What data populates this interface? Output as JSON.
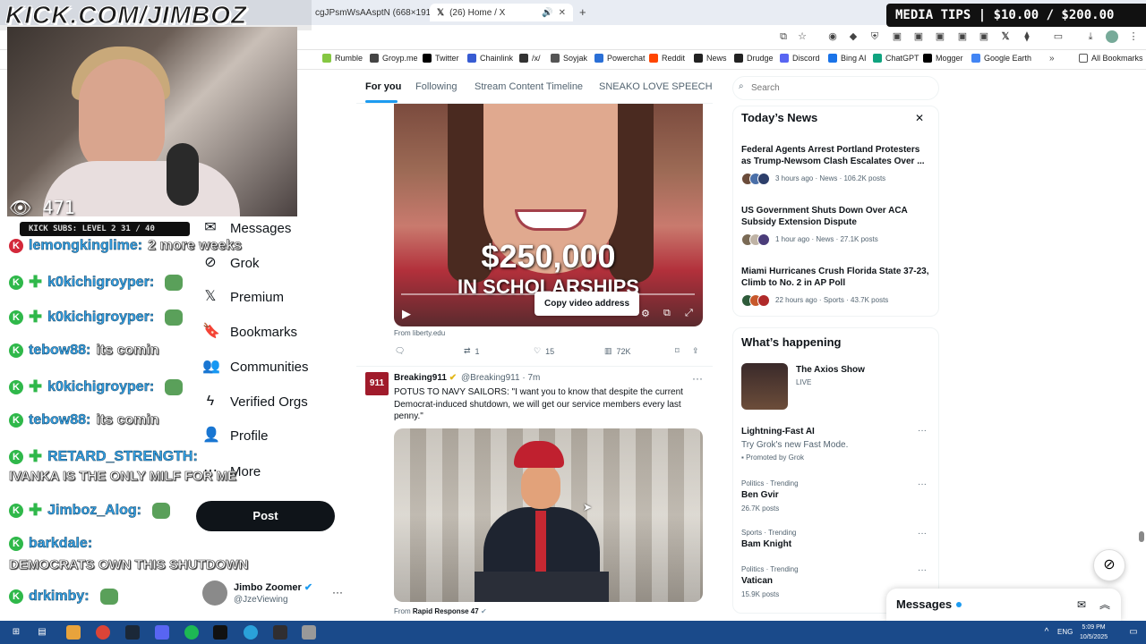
{
  "browser": {
    "tabs": [
      {
        "label": "cgJPsmWsAAsptN (668×191)",
        "active": false
      },
      {
        "label": "(26) Home / X",
        "active": true
      }
    ],
    "new_tab": "+",
    "bookmarks": [
      "Rumble",
      "Groyp.me",
      "Twitter",
      "Chainlink",
      "/x/",
      "Soyjak",
      "Powerchat",
      "Reddit",
      "News",
      "Drudge",
      "Discord",
      "Bing AI",
      "ChatGPT",
      "Mogger",
      "Google Earth"
    ],
    "all_bookmarks": "All Bookmarks",
    "bookmark_colors": [
      "#85c742",
      "#444",
      "#000",
      "#375bd2",
      "#333",
      "#555",
      "#2a6fd6",
      "#ff4500",
      "#222",
      "#222",
      "#5865f2",
      "#1a73e8",
      "#10a37f",
      "#000",
      "#4285f4"
    ]
  },
  "overlay": {
    "stream_url": "KICK.COM/JIMBOZ",
    "media_tips": "MEDIA TIPS | $10.00 / $200.00",
    "viewer_count": "471",
    "kick_subs": "KICK SUBS: LEVEL 2 31 / 40",
    "chat": [
      {
        "user": "lemongkinglime:",
        "msg": "2 more weeks"
      },
      {
        "user": "k0kichigroyper:",
        "msg": ""
      },
      {
        "user": "k0kichigroyper:",
        "msg": ""
      },
      {
        "user": "tebow88:",
        "msg": "its comin"
      },
      {
        "user": "k0kichigroyper:",
        "msg": ""
      },
      {
        "user": "tebow88:",
        "msg": "its comin"
      },
      {
        "user": "RETARD_STRENGTH:",
        "msg": "IVANKA IS THE ONLY MILF FOR ME"
      },
      {
        "user": "Jimboz_Alog:",
        "msg": ""
      },
      {
        "user": "barkdale:",
        "msg": "DEMOCRATS OWN THIS SHUTDOWN"
      },
      {
        "user": "drkimby:",
        "msg": ""
      }
    ]
  },
  "x_nav": {
    "items": [
      "Messages",
      "Grok",
      "Premium",
      "Bookmarks",
      "Communities",
      "Verified Orgs",
      "Profile",
      "More"
    ],
    "post_button": "Post",
    "account_name": "Jimbo Zoomer",
    "account_handle": "@JzeViewing"
  },
  "feed": {
    "tabs": [
      "For you",
      "Following",
      "Stream Content Timeline",
      "SNEAKO LOVE SPEECH"
    ],
    "tweet1": {
      "caption_big": "$250,000",
      "caption_small": "IN SCHOLARSHIPS",
      "context_menu": "Copy video address",
      "from": "From liberty.edu",
      "retweets": "1",
      "likes": "15",
      "views": "72K"
    },
    "tweet2": {
      "avatar_text": "911",
      "name": "Breaking911",
      "meta": "@Breaking911 · 7m",
      "text": "POTUS TO NAVY SAILORS: \"I want you to know that despite the current Democrat-induced shutdown, we will get our service members every last penny.\"",
      "from_prefix": "From",
      "from_source": "Rapid Response 47"
    }
  },
  "sidebar": {
    "search_placeholder": "Search",
    "todays_news_title": "Today’s News",
    "news": [
      {
        "headline": "Federal Agents Arrest Portland Protesters as Trump-Newsom Clash Escalates Over ...",
        "meta": "3 hours ago · News · 106.2K posts"
      },
      {
        "headline": "US Government Shuts Down Over ACA Subsidy Extension Dispute",
        "meta": "1 hour ago · News · 27.1K posts"
      },
      {
        "headline": "Miami Hurricanes Crush Florida State 37-23, Climb to No. 2 in AP Poll",
        "meta": "22 hours ago · Sports · 43.7K posts"
      }
    ],
    "whats_happening_title": "What’s happening",
    "axios": {
      "title": "The Axios Show",
      "status": "LIVE"
    },
    "promo": {
      "title": "Lightning-Fast AI",
      "desc": "Try Grok's new Fast Mode.",
      "promoted": "Promoted by Grok"
    },
    "trends": [
      {
        "label": "Politics · Trending",
        "name": "Ben Gvir",
        "count": "26.7K posts"
      },
      {
        "label": "Sports · Trending",
        "name": "Bam Knight",
        "count": ""
      },
      {
        "label": "Politics · Trending",
        "name": "Vatican",
        "count": "15.9K posts"
      }
    ],
    "messages_drawer": "Messages"
  },
  "taskbar": {
    "lang": "ENG",
    "time": "5:09 PM",
    "date": "10/5/2025"
  },
  "colors": {
    "x_blue": "#1d9bf0",
    "kick_green": "#2fb84a",
    "chat_username": "#35a2e6",
    "taskbar": "#1a4a8a"
  }
}
